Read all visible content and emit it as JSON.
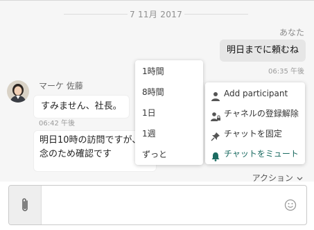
{
  "date_separator": "7 11月 2017",
  "my_message": {
    "sender": "あなた",
    "text": "明日までに頼むね",
    "time": "06:35 午後"
  },
  "their_messages": {
    "sender": "マーケ 佐藤",
    "first_text": "すみません、社長。",
    "first_time": "06:42 午後",
    "second_lines": [
      "明日10時の訪問ですが、",
      "念のため確認です"
    ]
  },
  "snooze_menu": [
    "1時間",
    "8時間",
    "1日",
    "1週",
    "ずっと"
  ],
  "action_menu": [
    {
      "label": "Add participant",
      "icon": "add-person-icon"
    },
    {
      "label": "チャネルの登録解除",
      "icon": "person-lock-icon"
    },
    {
      "label": "チャットを固定",
      "icon": "pin-icon"
    },
    {
      "label": "チャットをミュート",
      "icon": "bell-icon",
      "highlighted": true
    }
  ],
  "action_button": "アクション",
  "composer": {
    "placeholder": ""
  },
  "colors": {
    "accent": "#1b6b61",
    "bubble_mine": "#e6e6e6",
    "background": "#f6f6f6"
  }
}
